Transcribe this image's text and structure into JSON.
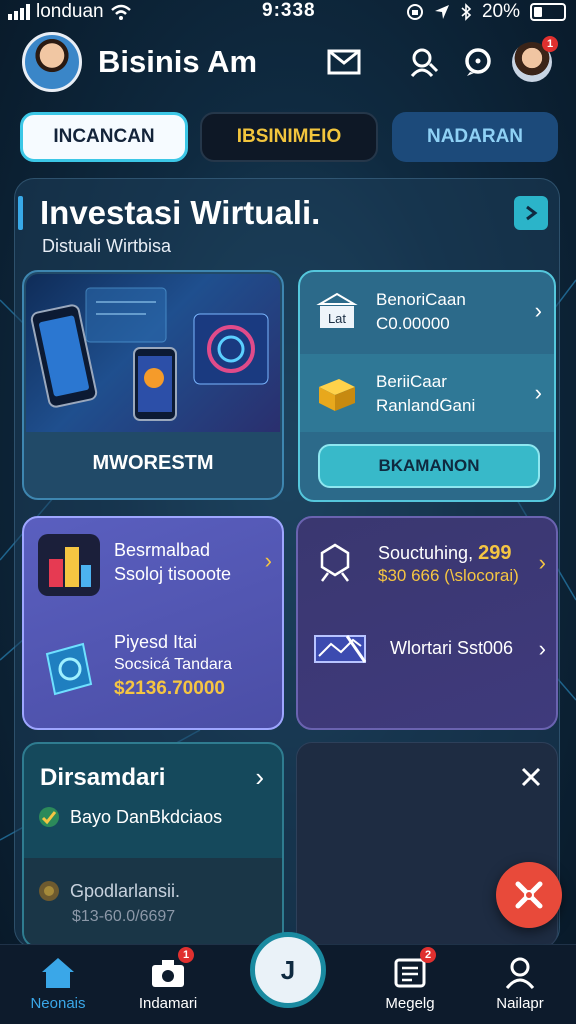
{
  "status_bar": {
    "carrier": "londuan",
    "time": "9:338",
    "battery": "20%"
  },
  "header": {
    "title": "Bisinis Am",
    "icons": [
      "mail-icon",
      "search-person-icon",
      "chat-icon"
    ],
    "profile_badge": "1"
  },
  "tabs": [
    {
      "label": "INCANCAN"
    },
    {
      "label": "IBSINIMEIO"
    },
    {
      "label": "NADARAN"
    }
  ],
  "section": {
    "title": "Investasi Wirtuali.",
    "subtitle": "Distuali Wirtbisa"
  },
  "cards": {
    "feature": {
      "label": "MWORESTM"
    },
    "list": {
      "item1": {
        "line1": "BenoriCaan",
        "line2": "C0.00000",
        "icon_text": "Lat"
      },
      "item2": {
        "line1": "BeriiCaar",
        "line2": "RanlandGani"
      },
      "button": "BKAMANON"
    },
    "purple_left": {
      "item1": {
        "line1": "Besrmalbad",
        "line2": "Ssoloj tisooote"
      },
      "item2": {
        "line1": "Piyesd Itai",
        "line2": "Socsicá Tandara",
        "line3": "$2136.70000"
      }
    },
    "purple_right": {
      "item1": {
        "line1": "Souctuhing,",
        "line1_value": "299",
        "line2": "$30 666 (\\slocorai)"
      },
      "item2": {
        "line1": "Wlortari Sst006"
      }
    },
    "teal": {
      "title": "Dirsamdari",
      "item1": "Bayo DanBkdciaos",
      "item2": {
        "line1": "Gpodlarlansii.",
        "line2": "$13-60.0/6697"
      }
    }
  },
  "bottom_nav": [
    {
      "label": "Neonais"
    },
    {
      "label": "Indamari",
      "badge": "1"
    },
    {
      "label": "Megelg",
      "badge": "2"
    },
    {
      "label": "Nailapr"
    }
  ],
  "center_button": "J",
  "colors": {
    "accent": "#38b9c9",
    "gold": "#f5c542",
    "fab": "#e84a3a",
    "nav_active": "#3aa7e8"
  }
}
